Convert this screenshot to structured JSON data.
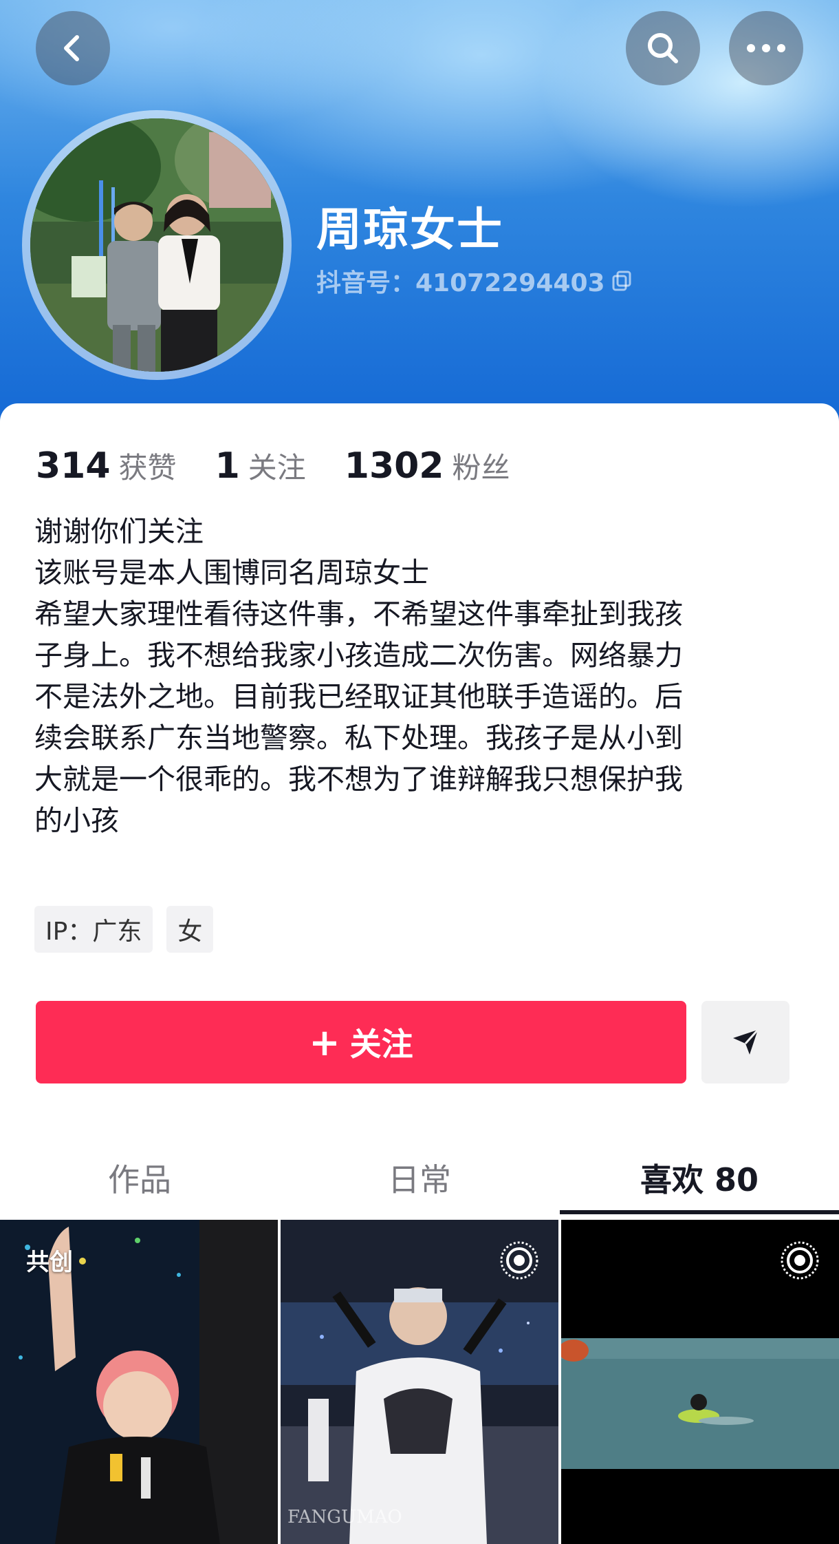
{
  "header": {
    "back_icon": "chevron-left-icon",
    "search_icon": "search-icon",
    "more_icon": "more-horizontal-icon"
  },
  "profile": {
    "name": "周琼女士",
    "douyin_id": "抖音号：41072294403",
    "copy_icon": "copy-icon"
  },
  "stats": [
    {
      "value": "314",
      "label": "获赞"
    },
    {
      "value": "1",
      "label": "关注"
    },
    {
      "value": "1302",
      "label": "粉丝"
    }
  ],
  "bio": {
    "lines": [
      "谢谢你们关注",
      "该账号是本人围博同名周琼女士",
      "希望大家理性看待这件事，不希望这件事牵扯到我孩",
      "子身上。我不想给我家小孩造成二次伤害。网络暴力",
      "不是法外之地。目前我已经取证其他联手造谣的。后",
      "续会联系广东当地警察。私下处理。我孩子是从小到",
      "大就是一个很乖的。我不想为了谁辩解我只想保护我",
      "的小孩"
    ]
  },
  "tags": {
    "ip": "IP：广东",
    "gender": "女"
  },
  "actions": {
    "follow_plus": "+",
    "follow_label": "关注",
    "share_icon": "send-icon"
  },
  "tabs": {
    "works": "作品",
    "daily": "日常",
    "likes": "喜欢 80",
    "active": "likes"
  },
  "videos": [
    {
      "badge": "共创"
    },
    {
      "badge_icon": "live-photo-icon",
      "watermark": "FANGUMAO"
    },
    {
      "badge_icon": "live-photo-icon"
    }
  ],
  "colors": {
    "accent": "#fe2c55",
    "header_blue": "#1367d4",
    "text_primary": "#161823",
    "text_secondary": "#7a7a80"
  }
}
